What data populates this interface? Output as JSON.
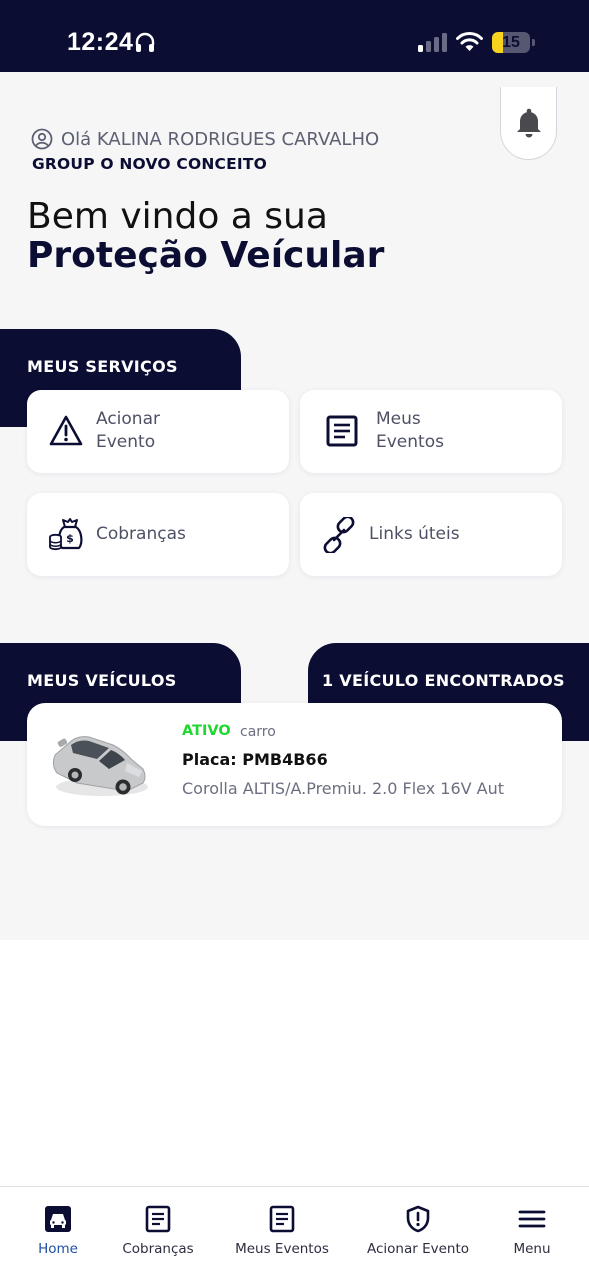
{
  "status_bar": {
    "time": "12:24",
    "battery": "15",
    "battery_level": 0.15
  },
  "header": {
    "greeting": "Olá KALINA RODRIGUES CARVALHO",
    "company": "GROUP O NOVO CONCEITO",
    "welcome_line1": "Bem vindo a sua",
    "welcome_line2": "Proteção Veícular"
  },
  "services": {
    "section_title": "MEUS SERVIÇOS",
    "items": [
      {
        "label_line1": "Acionar",
        "label_line2": "Evento",
        "icon": "warning-triangle-icon"
      },
      {
        "label_line1": "Meus",
        "label_line2": "Eventos",
        "icon": "document-list-icon"
      },
      {
        "label": "Cobranças",
        "icon": "money-bag-icon"
      },
      {
        "label": "Links úteis",
        "icon": "link-icon"
      }
    ]
  },
  "vehicles": {
    "section_title": "MEUS VEÍCULOS",
    "found_label": "1 VEÍCULO ENCONTRADOS",
    "items": [
      {
        "status": "ATIVO",
        "type": "carro",
        "plate": "Placa: PMB4B66",
        "model": "Corolla ALTIS/A.Premiu. 2.0 Flex 16V Aut"
      }
    ]
  },
  "bottom_nav": [
    {
      "label": "Home",
      "icon": "home-car-icon",
      "active": true
    },
    {
      "label": "Cobranças",
      "icon": "document-icon"
    },
    {
      "label": "Meus Eventos",
      "icon": "document-icon"
    },
    {
      "label": "Acionar Evento",
      "icon": "shield-alert-icon"
    },
    {
      "label": "Menu",
      "icon": "hamburger-menu-icon"
    }
  ],
  "colors": {
    "navy": "#0b0d33",
    "active_green": "#1ed72f",
    "nav_active": "#1f4fa9"
  }
}
